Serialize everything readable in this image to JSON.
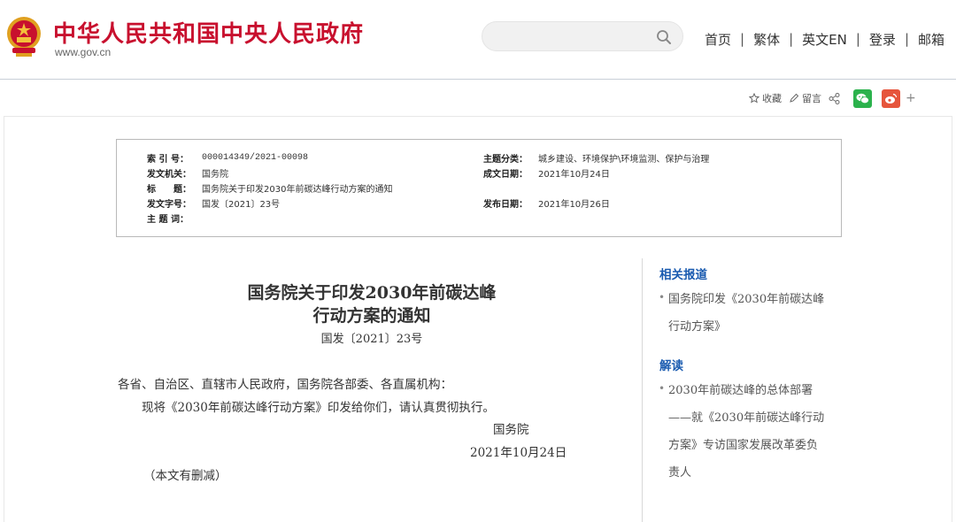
{
  "header": {
    "site_title": "中华人民共和国中央人民政府",
    "site_url": "www.gov.cn",
    "search_placeholder": "",
    "nav": [
      "首页",
      "繁体",
      "英文EN",
      "登录",
      "邮箱"
    ],
    "separator": "|"
  },
  "tools": {
    "favorite_label": "收藏",
    "comment_label": "留言",
    "plus": "+"
  },
  "meta": {
    "index_label": "索 引 号：",
    "index_value": "000014349/2021-00098",
    "topic_label": "主题分类：",
    "topic_value": "城乡建设、环境保护\\环境监测、保护与治理",
    "issuer_label": "发文机关：",
    "issuer_value": "国务院",
    "written_date_label": "成文日期：",
    "written_date_value": "2021年10月24日",
    "title_label": "标　　题：",
    "title_value": "国务院关于印发2030年前碳达峰行动方案的通知",
    "doc_no_label": "发文字号：",
    "doc_no_value": "国发〔2021〕23号",
    "publish_date_label": "发布日期：",
    "publish_date_value": "2021年10月26日",
    "keywords_label": "主 题 词：",
    "keywords_value": ""
  },
  "article": {
    "title_line1": "国务院关于印发2030年前碳达峰",
    "title_line2": "行动方案的通知",
    "doc_number": "国发〔2021〕23号",
    "addressee": "各省、自治区、直辖市人民政府，国务院各部委、各直属机构：",
    "body": "现将《2030年前碳达峰行动方案》印发给你们，请认真贯彻执行。",
    "signer": "国务院",
    "date": "2021年10月24日",
    "note": "（本文有删减）"
  },
  "sidebar": {
    "related_heading": "相关报道",
    "related_items": [
      {
        "line1": "国务院印发《2030年前碳达峰",
        "line2": "行动方案》"
      }
    ],
    "interpret_heading": "解读",
    "interpret_items": [
      {
        "line1": "2030年前碳达峰的总体部署",
        "line2": "——就《2030年前碳达峰行动",
        "line3": "方案》专访国家发展改革委负",
        "line4": "责人"
      }
    ]
  },
  "colors": {
    "brand_red": "#c8102e",
    "link_blue": "#1a5bb0",
    "wechat_green": "#2bb24c",
    "weibo_red": "#e6553c"
  }
}
